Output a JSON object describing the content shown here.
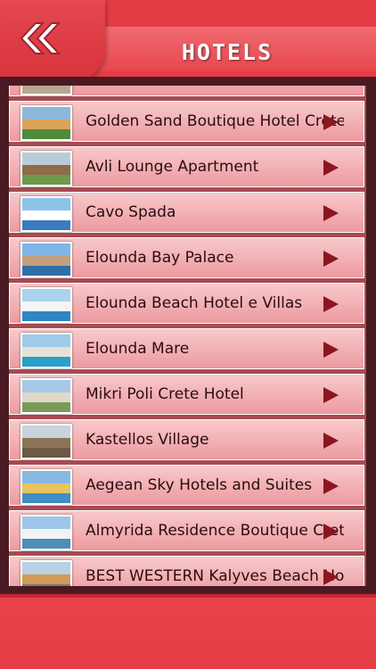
{
  "header": {
    "title": "HOTELS",
    "back_icon": "double-chevron-left-icon"
  },
  "colors": {
    "brand_red": "#e53c45",
    "frame_dark": "#4a1a22",
    "row_light": "#f8c9cb",
    "row_dark": "#ec9aa0",
    "arrow": "#8b1620"
  },
  "hotels": [
    {
      "name": "",
      "icon": "chevron-right-icon"
    },
    {
      "name": "Golden Sand Boutique Hotel Crete",
      "icon": "chevron-right-icon"
    },
    {
      "name": "Avli Lounge Apartment",
      "icon": "chevron-right-icon"
    },
    {
      "name": "Cavo Spada",
      "icon": "chevron-right-icon"
    },
    {
      "name": "Elounda Bay Palace",
      "icon": "chevron-right-icon"
    },
    {
      "name": "Elounda Beach Hotel e Villas",
      "icon": "chevron-right-icon"
    },
    {
      "name": "Elounda Mare",
      "icon": "chevron-right-icon"
    },
    {
      "name": "Mikri Poli Crete Hotel",
      "icon": "chevron-right-icon"
    },
    {
      "name": "Kastellos Village",
      "icon": "chevron-right-icon"
    },
    {
      "name": "Aegean Sky Hotels and Suites",
      "icon": "chevron-right-icon"
    },
    {
      "name": "Almyrida Residence Boutique Crete",
      "icon": "chevron-right-icon"
    },
    {
      "name": "BEST WESTERN Kalyves Beach Hotel",
      "icon": "chevron-right-icon"
    }
  ]
}
